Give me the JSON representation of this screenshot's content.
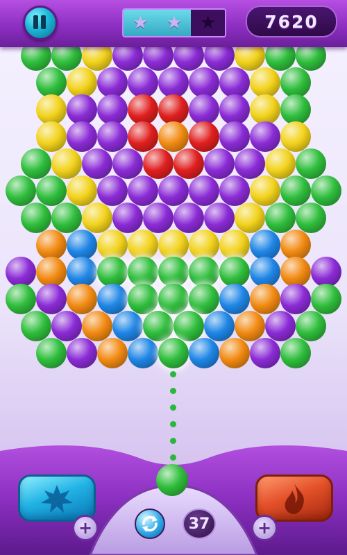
{
  "hud": {
    "score": "7620",
    "stars_earned": 2,
    "stars_total": 3
  },
  "launcher": {
    "shots_left": "37",
    "current_ball": "green",
    "next_ball": "blue"
  },
  "boosters": [
    {
      "name": "bomb",
      "color": "blue"
    },
    {
      "name": "fire",
      "color": "red"
    }
  ],
  "palette": {
    "G": "#2fbe3c",
    "Y": "#f2d21b",
    "P": "#8b2bd6",
    "R": "#e01f1f",
    "O": "#f28a12",
    "B": "#1f86e6"
  },
  "grid": {
    "rows": [
      "GGYPPPPYGG",
      "GYPPPPPYG",
      "YPPRRPPYG",
      "YPPRORPPY",
      "GYPPRRPPYG",
      "GGYPPPPPYGG",
      "GGYPPPPYGG",
      "OBYYYYYBO",
      "POBgggggBOP",
      "GPOBgggBOPG",
      "GPOBggBOPG",
      "GPOBgBOPG"
    ]
  }
}
